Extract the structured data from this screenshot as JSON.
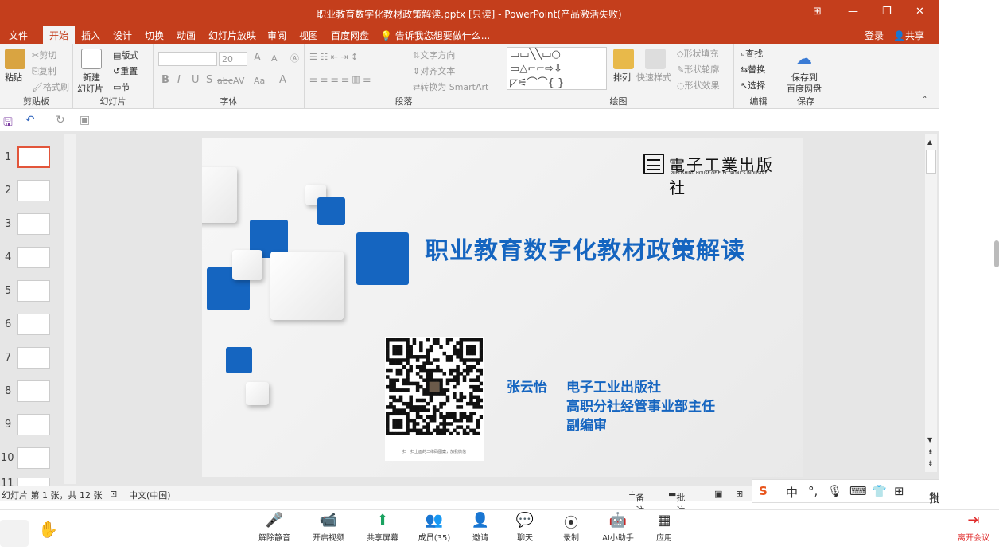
{
  "window": {
    "title": "职业教育数字化教材政策解读.pptx [只读] - PowerPoint(产品激活失败)",
    "controls": [
      "⊞",
      "—",
      "❐",
      "✕"
    ]
  },
  "menu": {
    "tabs": [
      "文件",
      "开始",
      "插入",
      "设计",
      "切换",
      "动画",
      "幻灯片放映",
      "审阅",
      "视图",
      "百度网盘"
    ],
    "active": "开始",
    "tell_me": "告诉我您想要做什么...",
    "login": "登录",
    "share": "共享"
  },
  "ribbon": {
    "clipboard": {
      "paste": "粘贴",
      "cut": "剪切",
      "copy": "复制",
      "format_painter": "格式刷",
      "label": "剪贴板"
    },
    "slides": {
      "new_slide": "新建",
      "new_slide2": "幻灯片",
      "layout": "版式",
      "reset": "重置",
      "section": "节",
      "label": "幻灯片"
    },
    "font": {
      "size": "20",
      "bold": "B",
      "italic": "I",
      "underline": "U",
      "strike": "S",
      "abc": "abc",
      "spacing": "AV",
      "case": "Aa",
      "color": "A",
      "grow": "A",
      "shrink": "A",
      "label": "字体"
    },
    "paragraph": {
      "text_direction": "文字方向",
      "align_text": "对齐文本",
      "smartart": "转换为 SmartArt",
      "label": "段落"
    },
    "drawing": {
      "arrange": "排列",
      "quick_styles": "快速样式",
      "shape_fill": "形状填充",
      "shape_outline": "形状轮廓",
      "shape_effects": "形状效果",
      "label": "绘图"
    },
    "editing": {
      "find": "查找",
      "replace": "替换",
      "select": "选择",
      "label": "编辑"
    },
    "save": {
      "save_to": "保存到",
      "baidu": "百度网盘",
      "label": "保存"
    }
  },
  "thumbnails": [
    "1",
    "2",
    "3",
    "4",
    "5",
    "6",
    "7",
    "8",
    "9",
    "10",
    "11"
  ],
  "slide": {
    "title": "职业教育数字化教材政策解读",
    "publisher_cn": "電子工業出版社",
    "publisher_en": "PUBLISHING HOUSE OF ELECTRONICS INDUSTRY",
    "author": "张云怡",
    "org_lines": [
      "电子工业出版社",
      "高职分社经管事业部主任",
      "副编审"
    ],
    "qr_caption": "扫一扫上面的二维码图案，加我微信"
  },
  "status": {
    "slide_info": "幻灯片 第 1 张，共 12 张",
    "language": "中文(中国)",
    "notes": "备注",
    "comments": "批注"
  },
  "ime": {
    "lang": "中",
    "annotate": "批注"
  },
  "meeting": {
    "buttons": [
      "解除静音",
      "开启视频",
      "共享屏幕",
      "成员(35)",
      "邀请",
      "聊天",
      "录制",
      "AI小助手",
      "应用"
    ],
    "leave": "离开会议"
  },
  "colors": {
    "accent": "#c43e1c",
    "slide_blue": "#1565c0"
  }
}
